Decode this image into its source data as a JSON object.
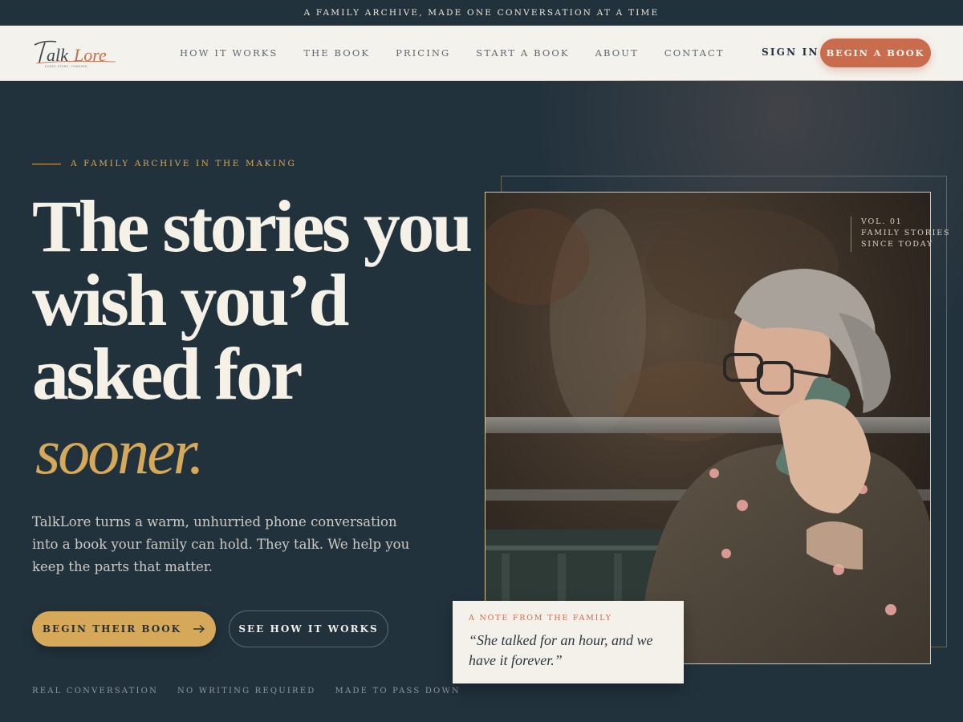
{
  "announcement": "A FAMILY ARCHIVE, MADE ONE CONVERSATION AT A TIME",
  "header": {
    "logo_text": "TalkLore",
    "logo_tagline": "EVERY STORY, FOREVER.",
    "nav": [
      "HOW IT WORKS",
      "THE BOOK",
      "PRICING",
      "START A BOOK",
      "ABOUT",
      "CONTACT"
    ],
    "sign_in": "SIGN IN",
    "begin_button": "BEGIN A BOOK"
  },
  "hero": {
    "eyebrow": "A FAMILY ARCHIVE IN THE MAKING",
    "headline_lines": [
      "The stories you",
      "wish you’d",
      "asked for"
    ],
    "headline_accent": "sooner.",
    "lede": "TalkLore turns a warm, unhurried phone conversation into a book your family can hold. They talk. We help you keep the parts that matter.",
    "cta_primary": "BEGIN THEIR BOOK",
    "cta_primary_icon": "arrow-right-icon",
    "cta_secondary": "SEE HOW IT WORKS",
    "features": [
      "REAL CONVERSATION",
      "NO WRITING REQUIRED",
      "MADE TO PASS DOWN"
    ]
  },
  "photo": {
    "vol_lines": [
      "VOL. 01",
      "FAMILY STORIES",
      "SINCE TODAY"
    ],
    "note_label": "A NOTE FROM THE FAMILY",
    "note_quote": "“She talked for an hour, and we have it forever.”"
  },
  "colors": {
    "background": "#22323d",
    "header_bg": "#f4f2ec",
    "accent_gold": "#d6a85a",
    "accent_terracotta": "#c96b4d",
    "text_light": "#f5f1e7"
  }
}
